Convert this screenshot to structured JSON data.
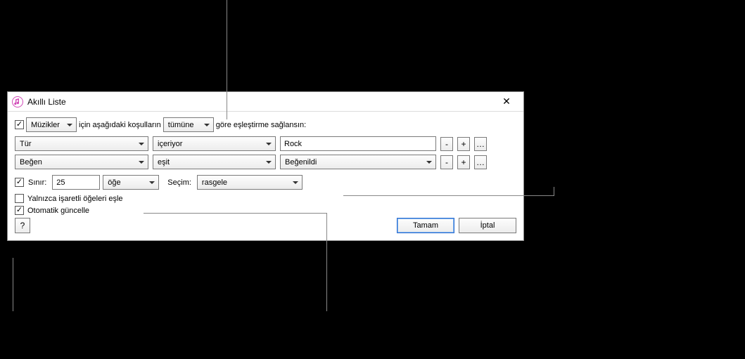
{
  "titlebar": {
    "title": "Akıllı Liste"
  },
  "match": {
    "media": "Müzikler",
    "text_prefix": "için aşağıdaki koşulların",
    "mode": "tümüne",
    "text_suffix": "göre eşleştirme sağlansın:"
  },
  "rules": [
    {
      "field": "Tür",
      "op": "içeriyor",
      "value": "Rock",
      "value_kind": "text"
    },
    {
      "field": "Beğen",
      "op": "eşit",
      "value": "Beğenildi",
      "value_kind": "select"
    }
  ],
  "limit": {
    "label": "Sınır:",
    "value": "25",
    "unit": "öğe",
    "select_label": "Seçim:",
    "select_by": "rasgele"
  },
  "options": {
    "match_checked_only": "Yalnızca işaretli öğeleri eşle",
    "live_update": "Otomatik güncelle"
  },
  "buttons": {
    "help": "?",
    "ok": "Tamam",
    "cancel": "İptal",
    "minus": "-",
    "plus": "+",
    "more": "…"
  }
}
